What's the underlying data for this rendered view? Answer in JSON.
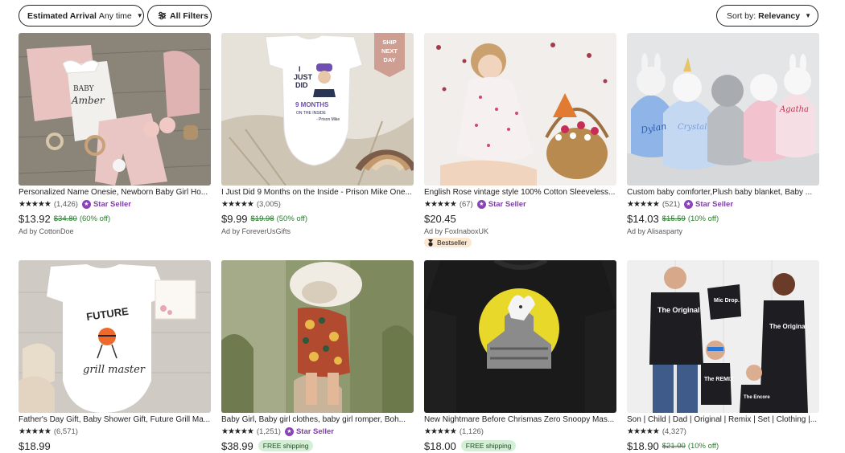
{
  "filters": {
    "arrival_label": "Estimated Arrival",
    "arrival_value": "Any time",
    "all_filters_label": "All Filters",
    "sort_label": "Sort by:",
    "sort_value": "Relevancy"
  },
  "colors": {
    "star_seller": "#7e3ea6",
    "sale_green": "#2e7d32",
    "free_shipping_bg": "#d4efd6",
    "bestseller_bg": "#fde7cf"
  },
  "stars_glyph": "★★★★★",
  "star_seller_label": "Star Seller",
  "products": [
    {
      "title": "Personalized Name Onesie, Newborn Baby Girl Ho...",
      "reviews": "(1,426)",
      "star_seller": true,
      "price": "$13.92",
      "original_price": "$34.80",
      "discount": "(60% off)",
      "ad_by": "Ad by CottonDoe"
    },
    {
      "title": "I Just Did 9 Months on the Inside - Prison Mike One...",
      "reviews": "(3,005)",
      "star_seller": false,
      "price": "$9.99",
      "original_price": "$19.98",
      "discount": "(50% off)",
      "ad_by": "Ad by ForeverUsGifts",
      "overlay_badge": "SHIP NEXT DAY",
      "onesie_text": [
        "I",
        "JUST",
        "DID",
        "9 MONTHS",
        "ON THE INSIDE",
        "- Prison Mike"
      ]
    },
    {
      "title": "English Rose vintage style 100% Cotton Sleeveless...",
      "reviews": "(67)",
      "star_seller": true,
      "price": "$20.45",
      "ad_by": "Ad by FoxInaboxUK",
      "bestseller": "Bestseller"
    },
    {
      "title": "Custom baby comforter,Plush baby blanket, Baby ...",
      "reviews": "(521)",
      "star_seller": true,
      "price": "$14.03",
      "original_price": "$15.59",
      "discount": "(10% off)",
      "ad_by": "Ad by Alisasparty",
      "names": [
        "Dylan",
        "Crystal",
        "Agatha"
      ]
    },
    {
      "title": "Father's Day Gift, Baby Shower Gift, Future Grill Ma...",
      "reviews": "(6,571)",
      "star_seller": false,
      "price": "$18.99",
      "onesie_text": [
        "FUTURE",
        "grill master"
      ]
    },
    {
      "title": "Baby Girl, Baby girl clothes, baby girl romper, Boh...",
      "reviews": "(1,251)",
      "star_seller": true,
      "price": "$38.99",
      "free_shipping": "FREE shipping"
    },
    {
      "title": "New Nightmare Before Chrismas Zero Snoopy Mas...",
      "reviews": "(1,126)",
      "star_seller": false,
      "price": "$18.00",
      "free_shipping": "FREE shipping"
    },
    {
      "title": "Son | Child | Dad | Original | Remix | Set | Clothing |...",
      "reviews": "(4,327)",
      "star_seller": false,
      "price": "$18.90",
      "original_price": "$21.00",
      "discount": "(10% off)",
      "shirt_text": [
        "The Original",
        "Mic Drop.",
        "The Original",
        "The REMIX",
        "The Encore"
      ]
    }
  ]
}
